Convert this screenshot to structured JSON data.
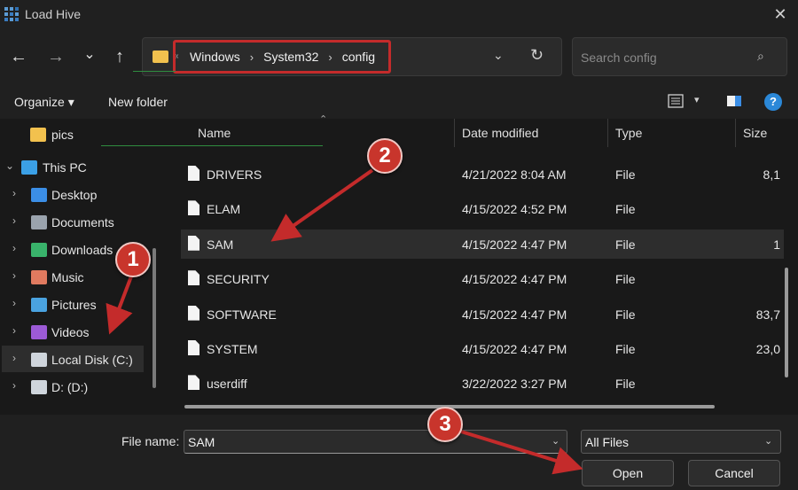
{
  "window": {
    "title": "Load Hive",
    "close_symbol": "✕"
  },
  "nav": {
    "back": "←",
    "forward": "→",
    "recent": "⌄",
    "up": "↑",
    "breadcrumb": [
      "Windows",
      "System32",
      "config"
    ],
    "breadcrumb_separator": "›",
    "dropdown": "⌄",
    "refresh": "↻",
    "search_placeholder": "Search config",
    "search_icon": "⌕"
  },
  "toolbar": {
    "organize": "Organize ▾",
    "new_folder": "New folder"
  },
  "sidebar": [
    {
      "label": "pics",
      "icon": "folder-icon",
      "color": "#f2c14e",
      "expander": ""
    },
    {
      "label": "This PC",
      "icon": "pc-icon",
      "color": "#3ba0e6",
      "expander": "⌄"
    },
    {
      "label": "Desktop",
      "icon": "desktop-icon",
      "color": "#3b8ee6",
      "expander": "›"
    },
    {
      "label": "Documents",
      "icon": "documents-icon",
      "color": "#9aa3ad",
      "expander": "›"
    },
    {
      "label": "Downloads",
      "icon": "downloads-icon",
      "color": "#39b36b",
      "expander": "›"
    },
    {
      "label": "Music",
      "icon": "music-icon",
      "color": "#e07a5f",
      "expander": "›"
    },
    {
      "label": "Pictures",
      "icon": "pictures-icon",
      "color": "#4aa3e0",
      "expander": "›"
    },
    {
      "label": "Videos",
      "icon": "videos-icon",
      "color": "#9c5ad6",
      "expander": "›"
    },
    {
      "label": "Local Disk (C:)",
      "icon": "drive-icon",
      "color": "#cfd5dc",
      "expander": "›"
    },
    {
      "label": "D: (D:)",
      "icon": "drive-icon",
      "color": "#cfd5dc",
      "expander": "›"
    }
  ],
  "columns": {
    "name": "Name",
    "date_modified": "Date modified",
    "type": "Type",
    "size": "Size"
  },
  "files": [
    {
      "name": "DRIVERS",
      "date": "4/21/2022 8:04 AM",
      "type": "File",
      "size": "8,1"
    },
    {
      "name": "ELAM",
      "date": "4/15/2022 4:52 PM",
      "type": "File",
      "size": ""
    },
    {
      "name": "SAM",
      "date": "4/15/2022 4:47 PM",
      "type": "File",
      "size": "1"
    },
    {
      "name": "SECURITY",
      "date": "4/15/2022 4:47 PM",
      "type": "File",
      "size": ""
    },
    {
      "name": "SOFTWARE",
      "date": "4/15/2022 4:47 PM",
      "type": "File",
      "size": "83,7"
    },
    {
      "name": "SYSTEM",
      "date": "4/15/2022 4:47 PM",
      "type": "File",
      "size": "23,0"
    },
    {
      "name": "userdiff",
      "date": "3/22/2022 3:27 PM",
      "type": "File",
      "size": ""
    }
  ],
  "selected_file": "SAM",
  "bottom": {
    "file_name_label": "File name:",
    "file_name_value": "SAM",
    "filter": "All Files",
    "open": "Open",
    "cancel": "Cancel"
  },
  "callouts": [
    "1",
    "2",
    "3"
  ],
  "colors": {
    "accent_red": "#c42b2b",
    "callout_red": "#c8352c",
    "help_blue": "#2b88d8",
    "folder_yellow": "#f2c14e"
  }
}
